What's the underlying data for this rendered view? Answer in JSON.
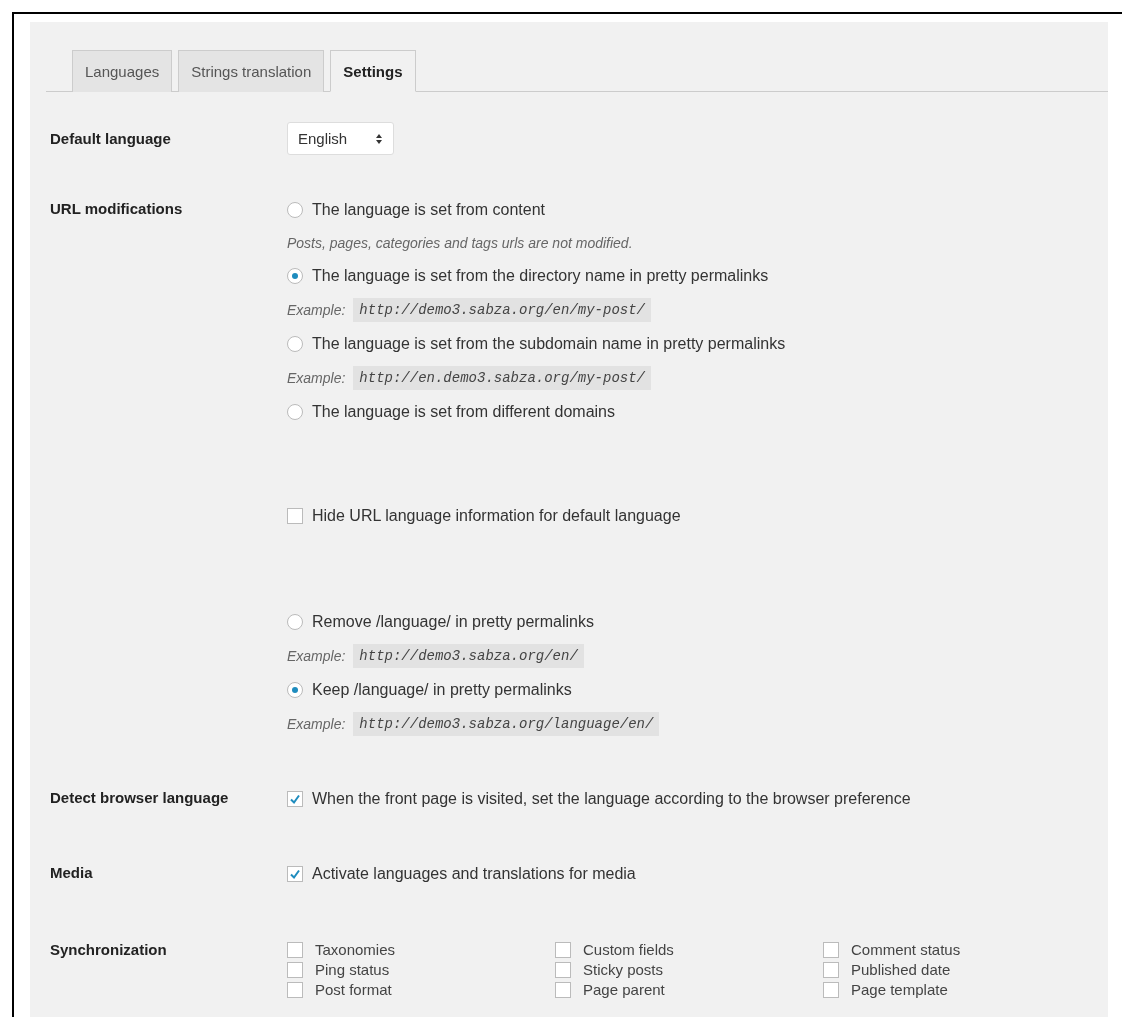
{
  "tabs": [
    {
      "label": "Languages",
      "selected": false
    },
    {
      "label": "Strings translation",
      "selected": false
    },
    {
      "label": "Settings",
      "selected": true
    }
  ],
  "settings": [
    {
      "kind": "select",
      "label": "Default language",
      "value": "English"
    },
    {
      "kind": "options",
      "label": "URL modifications",
      "options": [
        {
          "kind": "radio",
          "label": "The language is set from content",
          "selected": false
        },
        {
          "kind": "note",
          "text": "Posts, pages, categories and tags urls are not modified."
        },
        {
          "kind": "radio",
          "label": "The language is set from the directory name in pretty permalinks",
          "selected": true
        },
        {
          "kind": "example",
          "prefix": "Example:",
          "url": "http://demo3.sabza.org/en/my-post/"
        },
        {
          "kind": "radio",
          "label": "The language is set from the subdomain name in pretty permalinks",
          "selected": false
        },
        {
          "kind": "example",
          "prefix": "Example:",
          "url": "http://en.demo3.sabza.org/my-post/"
        },
        {
          "kind": "radio",
          "label": "The language is set from different domains",
          "selected": false
        },
        {
          "kind": "checkbox",
          "label": "Hide URL language information for default language",
          "checked": false
        },
        {
          "kind": "radio",
          "label": "Remove /language/ in pretty permalinks",
          "selected": false
        },
        {
          "kind": "example",
          "prefix": "Example:",
          "url": "http://demo3.sabza.org/en/"
        },
        {
          "kind": "radio",
          "label": "Keep /language/ in pretty permalinks",
          "selected": true
        },
        {
          "kind": "example",
          "prefix": "Example:",
          "url": "http://demo3.sabza.org/language/en/"
        }
      ]
    },
    {
      "kind": "checkbox",
      "label": "Detect browser language",
      "text": "When the front page is visited, set the language according to the browser preference",
      "checked": true
    },
    {
      "kind": "checkbox",
      "label": "Media",
      "text": "Activate languages and translations for media",
      "checked": true
    },
    {
      "kind": "grid",
      "label": "Synchronization",
      "items": [
        {
          "label": "Taxonomies",
          "checked": false
        },
        {
          "label": "Custom fields",
          "checked": false
        },
        {
          "label": "Comment status",
          "checked": false
        },
        {
          "label": "Ping status",
          "checked": false
        },
        {
          "label": "Sticky posts",
          "checked": false
        },
        {
          "label": "Published date",
          "checked": false
        },
        {
          "label": "Post format",
          "checked": false
        },
        {
          "label": "Page parent",
          "checked": false
        },
        {
          "label": "Page template",
          "checked": false
        }
      ]
    }
  ]
}
